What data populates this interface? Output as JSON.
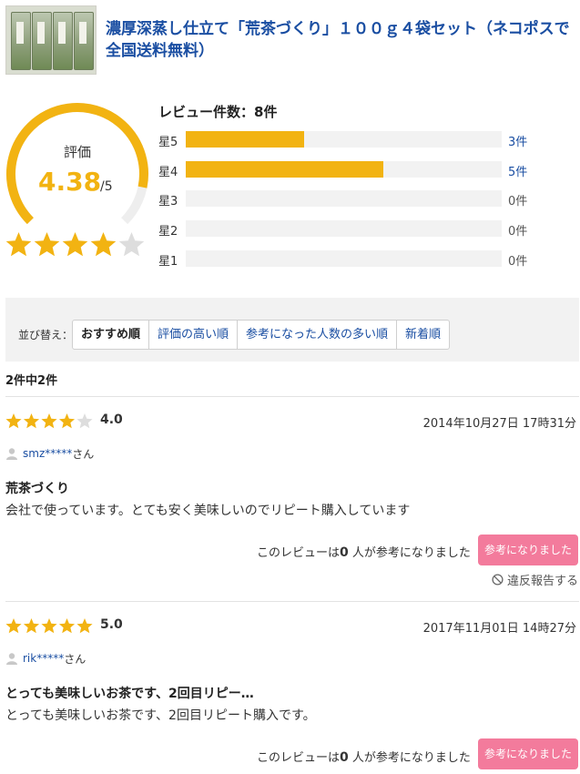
{
  "product": {
    "title": "濃厚深蒸し仕立て「荒茶づくり」１００ｇ４袋セット（ネコポスで全国送料無料）"
  },
  "summary": {
    "rating_label": "評価",
    "rating_value": "4.38",
    "rating_max": "/5",
    "average_rating": 4.38,
    "review_count_label": "レビュー件数：8件",
    "histogram": [
      {
        "label": "星5",
        "count_text": "3件",
        "fraction": 0.375,
        "link": true
      },
      {
        "label": "星4",
        "count_text": "5件",
        "fraction": 0.625,
        "link": true
      },
      {
        "label": "星3",
        "count_text": "0件",
        "fraction": 0,
        "link": false
      },
      {
        "label": "星2",
        "count_text": "0件",
        "fraction": 0,
        "link": false
      },
      {
        "label": "星1",
        "count_text": "0件",
        "fraction": 0,
        "link": false
      }
    ]
  },
  "sort": {
    "label": "並び替え：",
    "options": [
      "おすすめ順",
      "評価の高い順",
      "参考になった人数の多い順",
      "新着順"
    ],
    "selected": "おすすめ順"
  },
  "result_count": "2件中2件",
  "reviews": [
    {
      "stars": 4,
      "score": "4.0",
      "date": "2014年10月27日 17時31分",
      "user": "smz*****",
      "user_suffix": "さん",
      "title": "荒茶づくり",
      "body": "会社で使っています。とても安く美味しいのでリピート購入しています",
      "helpful_prefix": "このレビューは",
      "helpful_count": "0",
      "helpful_suffix": " 人が参考になりました",
      "helpful_button": "参考になりました",
      "report": "違反報告する"
    },
    {
      "stars": 5,
      "score": "5.0",
      "date": "2017年11月01日 14時27分",
      "user": "rik*****",
      "user_suffix": "さん",
      "title": "とっても美味しいお茶です、2回目リピー…",
      "body": "とっても美味しいお茶です、2回目リピート購入です。",
      "helpful_prefix": "このレビューは",
      "helpful_count": "0",
      "helpful_suffix": " 人が参考になりました",
      "helpful_button": "参考になりました"
    }
  ],
  "colors": {
    "accent_gold": "#f2b312",
    "link_blue": "#1a4ea2",
    "helpful_pink": "#f37b9c",
    "star_empty": "#dddddd"
  }
}
